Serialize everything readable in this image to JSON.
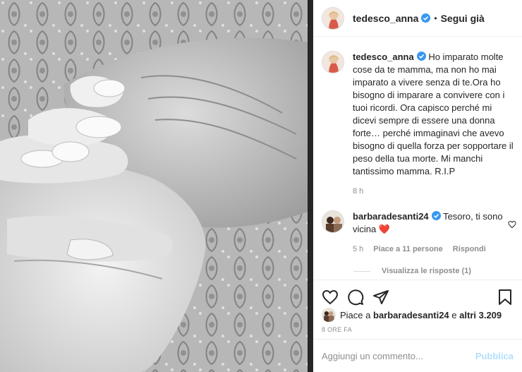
{
  "post": {
    "username": "tedesco_anna",
    "follow_separator": "•",
    "follow_label": "Segui già",
    "caption": "Ho imparato molte cose da te mamma, ma non ho mai imparato a vivere senza di te.Ora ho bisogno di imparare a convivere con i tuoi ricordi. Ora capisco perché mi dicevi sempre di essere una donna forte… perché immaginavi che avevo bisogno di quella forza per sopportare il peso della tua morte. Mi manchi tantissimo mamma. R.I.P",
    "caption_time": "8 h"
  },
  "comment": {
    "username": "barbaradesanti24",
    "text": "Tesoro, ti sono vicina",
    "emoji": "❤️",
    "time": "5 h",
    "likes": "Piace a 11 persone",
    "reply": "Rispondi",
    "view_replies": "Visualizza le risposte (1)"
  },
  "likes": {
    "prefix": "Piace a",
    "user": "barbaradesanti24",
    "and_others": "e",
    "others": "altri 3.209"
  },
  "post_time": "8 ORE FA",
  "add_comment": {
    "placeholder": "Aggiungi un commento...",
    "publish_label": "Pubblica"
  },
  "icons": {
    "like": "heart-icon",
    "comment": "comment-icon",
    "share": "share-icon",
    "save": "bookmark-icon",
    "verified": "verified-badge-icon"
  },
  "colors": {
    "verified": "#3897f0",
    "emoji_heart": "#e0245e",
    "publish": "#b2dffc",
    "divider": "#262626"
  }
}
